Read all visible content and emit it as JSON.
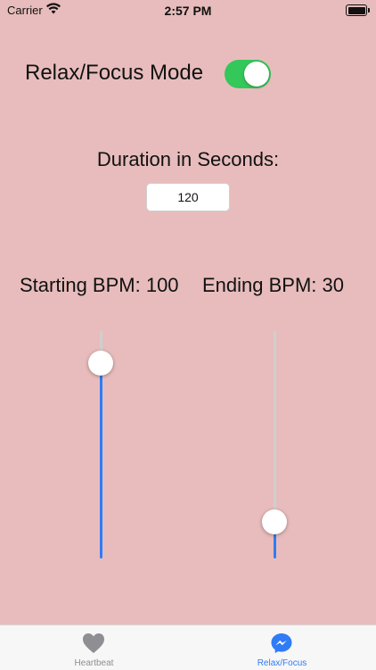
{
  "status_bar": {
    "carrier": "Carrier",
    "time": "2:57 PM"
  },
  "mode": {
    "label": "Relax/Focus Mode",
    "enabled": true
  },
  "duration": {
    "label": "Duration in Seconds:",
    "value": "120"
  },
  "bpm": {
    "start_label": "Starting BPM: 100",
    "end_label": "Ending BPM: 30",
    "start_level": 0.86,
    "end_level": 0.16
  },
  "colors": {
    "background": "#e8bcbc",
    "accent": "#2f7cf6",
    "toggle_on": "#34c759",
    "inactive_tab": "#8e8e93"
  },
  "tab_bar": {
    "tabs": [
      {
        "label": "Heartbeat",
        "icon": "heart-icon",
        "selected": false
      },
      {
        "label": "Relax/Focus",
        "icon": "messenger-icon",
        "selected": true
      }
    ]
  }
}
